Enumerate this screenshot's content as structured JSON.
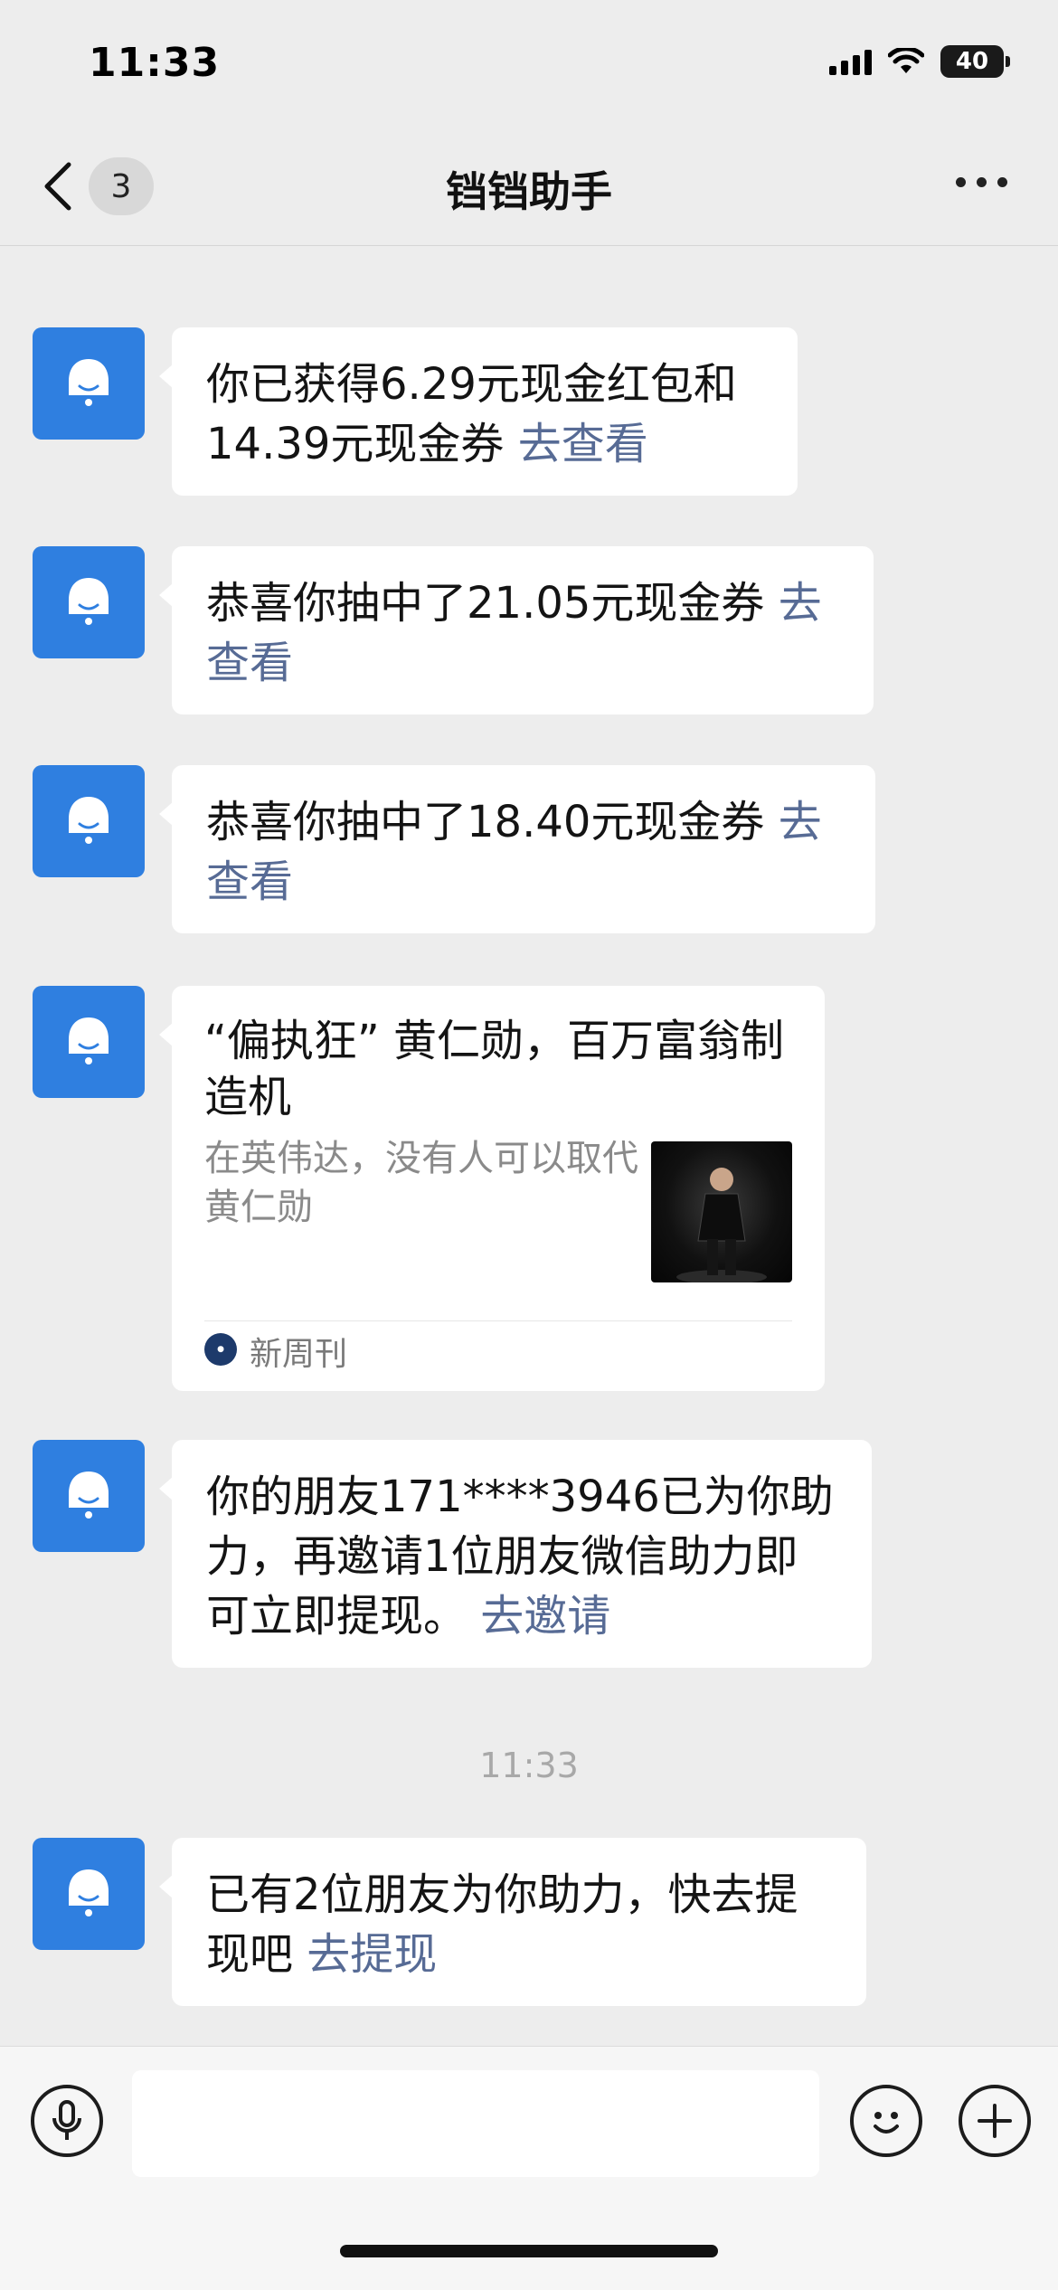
{
  "status_bar": {
    "time": "11:33",
    "battery": "40"
  },
  "header": {
    "unread_count": "3",
    "title": "铛铛助手"
  },
  "messages": [
    {
      "text": "你已获得6.29元现金红包和14.39元现金券",
      "link": "去查看"
    },
    {
      "text": "恭喜你抽中了21.05元现金券",
      "link": "去查看"
    },
    {
      "text": "恭喜你抽中了18.40元现金券",
      "link": "去查看"
    },
    {
      "text": "你的朋友171****3946已为你助力，再邀请1位朋友微信助力即可立即提现。",
      "link": "去邀请"
    },
    {
      "text": "已有2位朋友为你助力，快去提现吧",
      "link": "去提现"
    }
  ],
  "article": {
    "title": "“偏执狂” 黄仁勋，百万富翁制造机",
    "description": "在英伟达，没有人可以取代黄仁勋",
    "source": "新周刊"
  },
  "timestamp": "11:33",
  "icons": {
    "avatar": "bell-icon",
    "back": "chevron-left-icon",
    "more": "more-dots-icon",
    "voice": "microphone-icon",
    "emoji": "emoji-icon",
    "plus": "plus-icon"
  },
  "colors": {
    "link": "#576b95",
    "avatar_bg": "#2f7fe0",
    "background": "#ededed"
  }
}
